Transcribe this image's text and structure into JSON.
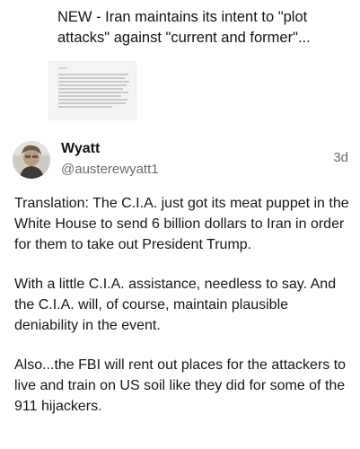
{
  "quoted_post": {
    "title": "NEW - Iran maintains its intent to \"plot attacks\" against \"current and former\"..."
  },
  "post": {
    "author_name": "Wyatt",
    "handle": "@austerewyatt1",
    "time": "3d",
    "paragraphs": [
      "Translation: The C.I.A. just got its meat puppet in the White House to send 6 billion dollars to Iran in order for them to take out President Trump.",
      "With a little C.I.A. assistance, needless to say. And the C.I.A. will, of course, maintain plausible deniability in the event.",
      "Also...the FBI will rent out places for the attackers to live and train on US soil like they did for some of the 911 hijackers."
    ]
  },
  "icons": {
    "avatar": "profile-photo"
  }
}
